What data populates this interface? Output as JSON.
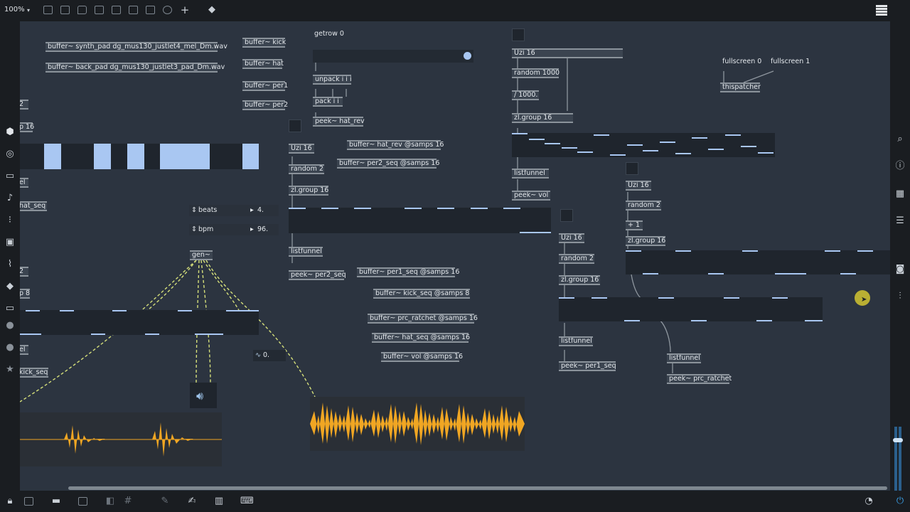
{
  "toolbar": {
    "zoom": "100%",
    "icons": [
      "new-object-icon",
      "message-icon",
      "comment-icon",
      "button-icon",
      "toggle-icon",
      "number-icon",
      "slider-icon",
      "dial-icon",
      "add-icon",
      "paint-icon"
    ],
    "grid_icon": "grid-menu-icon"
  },
  "left_sidebar": {
    "icons": [
      "package-icon",
      "target-icon",
      "folder-icon",
      "music-note-icon",
      "step-icon",
      "image-icon",
      "clip-icon",
      "plug-icon",
      "loop-icon",
      "vst-icon",
      "bpatcher-icon",
      "star-icon"
    ]
  },
  "right_sidebar": {
    "icons": [
      "search-icon",
      "info-icon",
      "inspector-icon",
      "list-icon",
      "camera-icon",
      "mixer-icon"
    ]
  },
  "bottom_toolbar": {
    "icons": [
      "lock-icon",
      "presentation-icon",
      "comment-icon",
      "layers-icon",
      "hide-icon",
      "grid-icon",
      "debug-icon",
      "wrench-icon",
      "piano-icon",
      "keyboard-icon",
      "transport-icon",
      "power-icon"
    ]
  },
  "objects": {
    "buf_synth_pad": "buffer~ synth_pad dg_mus130_justlet4_mel_Dm.wav",
    "buf_back_pad": "buffer~ back_pad dg_mus130_justlet3_pad_Dm.wav",
    "buf_kick": "buffer~ kick",
    "buf_hat": "buffer~ hat",
    "buf_per1": "buffer~ per1",
    "buf_per2": "buffer~ per2",
    "getrow": "getrow 0",
    "unpack": "unpack i i i",
    "pack": "pack i i",
    "peek_hat_rev": "peek~ hat_rev",
    "uzi_a": "Uzi 16",
    "random_a": "random 2",
    "zlgroup_a": "zl.group 16",
    "buf_hat_rev": "buffer~ hat_rev @samps 16",
    "buf_per2_seq": "buffer~ per2_seq @samps 16",
    "listfunnel_a": "listfunnel",
    "peek_per2_seq": "peek~ per2_seq",
    "beats_label": "beats",
    "beats_value": "4.",
    "bpm_label": "bpm",
    "bpm_value": "96.",
    "gen": "gen~",
    "sig_value": "0.",
    "left_partial_1": "2",
    "left_partial_2": "p 16",
    "left_partial_3": "el",
    "left_partial_4": "hat_seq",
    "left_partial_5": "2",
    "left_partial_6": "p 8",
    "left_partial_7": "el",
    "left_partial_8": "kick_seq",
    "buf_per1_seq": "buffer~ per1_seq @samps 16",
    "buf_kick_seq": "buffer~ kick_seq @samps 8",
    "buf_prc_ratchet": "buffer~ prc_ratchet @samps 16",
    "buf_hat_seq": "buffer~ hat_seq @samps 16",
    "buf_vol": "buffer~ vol @samps 16",
    "uzi_b": "Uzi 16",
    "random_b": "random 1000",
    "div_b": "/ 1000.",
    "zlgroup_b": "zl.group 16",
    "listfunnel_b": "listfunnel",
    "peek_vol": "peek~ vol",
    "uzi_c": "Uzi 16",
    "random_c": "random 2",
    "zlgroup_c": "zl.group 16",
    "listfunnel_c": "listfunnel",
    "peek_per1_seq": "peek~ per1_seq",
    "fullscreen0": "fullscreen 0",
    "fullscreen1": "fullscreen 1",
    "thispatcher": "thispatcher",
    "uzi_d": "Uzi 16",
    "random_d": "random 2",
    "plus1": "+ 1",
    "zlgroup_d": "zl.group 16",
    "listfunnel_d": "listfunnel",
    "peek_prc_ratchet": "peek~ prc_ratchet"
  },
  "colors": {
    "canvas": "#2c3440",
    "object": "#3b4450",
    "slider_bar": "#a9c7f2",
    "patch_cord_signal": "#d6e07a",
    "waveform": "#f0a623",
    "cursor": "#d2c531"
  }
}
